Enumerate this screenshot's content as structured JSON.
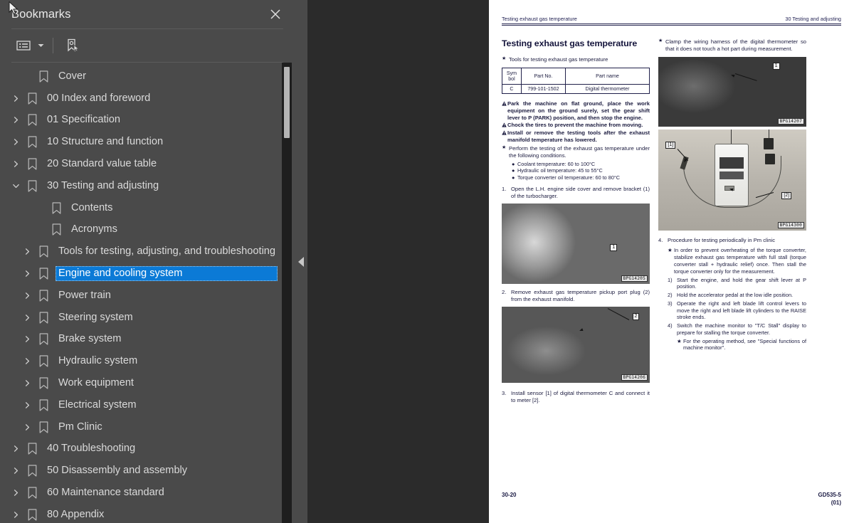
{
  "panel": {
    "title": "Bookmarks",
    "close_icon": "close-icon",
    "toolbar": {
      "options_icon": "list-options-icon",
      "caret_icon": "chevron-down-icon",
      "new_bookmark_icon": "new-bookmark-icon"
    },
    "items": [
      {
        "label": "Cover",
        "level": 1,
        "arrow": "none",
        "selected": false
      },
      {
        "label": "00 Index and foreword",
        "level": 0,
        "arrow": "collapsed",
        "selected": false
      },
      {
        "label": "01 Specification",
        "level": 0,
        "arrow": "collapsed",
        "selected": false
      },
      {
        "label": "10 Structure and function",
        "level": 0,
        "arrow": "collapsed",
        "selected": false
      },
      {
        "label": "20 Standard value table",
        "level": 0,
        "arrow": "collapsed",
        "selected": false
      },
      {
        "label": "30 Testing and adjusting",
        "level": 0,
        "arrow": "expanded",
        "selected": false
      },
      {
        "label": "Contents",
        "level": 2,
        "arrow": "none",
        "selected": false
      },
      {
        "label": "Acronyms",
        "level": 2,
        "arrow": "none",
        "selected": false
      },
      {
        "label": "Tools for testing, adjusting, and troubleshooting",
        "level": 1,
        "arrow": "collapsed",
        "selected": false
      },
      {
        "label": "Engine and cooling system",
        "level": 1,
        "arrow": "collapsed",
        "selected": true
      },
      {
        "label": "Power train",
        "level": 1,
        "arrow": "collapsed",
        "selected": false
      },
      {
        "label": "Steering system",
        "level": 1,
        "arrow": "collapsed",
        "selected": false
      },
      {
        "label": "Brake system",
        "level": 1,
        "arrow": "collapsed",
        "selected": false
      },
      {
        "label": "Hydraulic system",
        "level": 1,
        "arrow": "collapsed",
        "selected": false
      },
      {
        "label": "Work equipment",
        "level": 1,
        "arrow": "collapsed",
        "selected": false
      },
      {
        "label": "Electrical system",
        "level": 1,
        "arrow": "collapsed",
        "selected": false
      },
      {
        "label": "Pm Clinic",
        "level": 1,
        "arrow": "collapsed",
        "selected": false
      },
      {
        "label": "40 Troubleshooting",
        "level": 0,
        "arrow": "collapsed",
        "selected": false
      },
      {
        "label": "50 Disassembly and assembly",
        "level": 0,
        "arrow": "collapsed",
        "selected": false
      },
      {
        "label": "60 Maintenance standard",
        "level": 0,
        "arrow": "collapsed",
        "selected": false
      },
      {
        "label": "80 Appendix",
        "level": 0,
        "arrow": "collapsed",
        "selected": false
      }
    ],
    "selection_color": "#0b7ad6"
  },
  "splitter": {
    "collapse_icon": "triangle-left-icon"
  },
  "page": {
    "running_head_left": "Testing exhaust gas temperature",
    "running_head_right": "30 Testing and adjusting",
    "title": "Testing exhaust gas temperature",
    "tools_line": "Tools for testing exhaust gas temperature",
    "tools_table": {
      "headers": [
        "Sym bol",
        "Part No.",
        "Part name"
      ],
      "header_sym_line1": "Sym",
      "header_sym_line2": "bol",
      "rows": [
        {
          "symbol": "C",
          "part_no": "799-101-1502",
          "part_name": "Digital thermometer"
        }
      ]
    },
    "warnings": [
      "Park the machine on flat ground, place the work equipment on the ground surely, set the gear shift lever to P (PARK) position, and then stop the engine.",
      "Chock the tires to prevent the machine from moving.",
      "Install or remove the testing tools after the exhaust manifold temperature has lowered."
    ],
    "conditions_intro": "Perform the testing of the exhaust gas temperature under the following conditions.",
    "conditions": [
      "Coolant temperature: 60 to 100°C",
      "Hydraulic oil temperature: 45 to 55°C",
      "Torque converter oil temperature: 60 to 80°C"
    ],
    "steps": [
      {
        "n": "1.",
        "text": "Open the L.H. engine side cover and remove bracket (1) of the turbocharger."
      },
      {
        "n": "2.",
        "text": "Remove exhaust gas temperature pickup port plug (2) from the exhaust manifold."
      },
      {
        "n": "3.",
        "text": "Install sensor [1] of digital thermometer C and connect it to meter [2]."
      }
    ],
    "right_note": "Clamp the wiring harness of the digital thermometer so that it does not touch a hot part during measurement.",
    "step4": {
      "n": "4.",
      "title": "Procedure for testing periodically in Pm clinic",
      "star_note": "In order to prevent overheating of the torque converter, stabilize exhaust gas temperature with full stall (torque converter stall + hydraulic relief) once. Then stall the torque converter only for the measurement.",
      "substeps": [
        {
          "n": "1)",
          "text": "Start the engine, and hold the gear shift lever at P position."
        },
        {
          "n": "2)",
          "text": "Hold the accelerator pedal at the low idle position."
        },
        {
          "n": "3)",
          "text": "Operate the right and left blade lift control levers to move the right and left blade lift cylinders to the RAISE stroke ends."
        },
        {
          "n": "4)",
          "text": "Switch the machine monitor to \"T/C Stall\" display to prepare for stalling the torque converter."
        }
      ],
      "final_star": "For the operating method, see \"Special functions of machine monitor\"."
    },
    "figures": {
      "turbocharger": {
        "tag": "BPG14205",
        "callout": "1"
      },
      "manifold": {
        "tag": "BPG14206",
        "callout": "2"
      },
      "engine_harness": {
        "tag": "BPG14207",
        "callout": "1"
      },
      "thermometer": {
        "tag": "BPG14300",
        "callout_left": "[1]",
        "callout_right": "[2]"
      }
    },
    "footer_left": "30-20",
    "footer_right_line1": "GD535-5",
    "footer_right_line2": "(01)"
  }
}
